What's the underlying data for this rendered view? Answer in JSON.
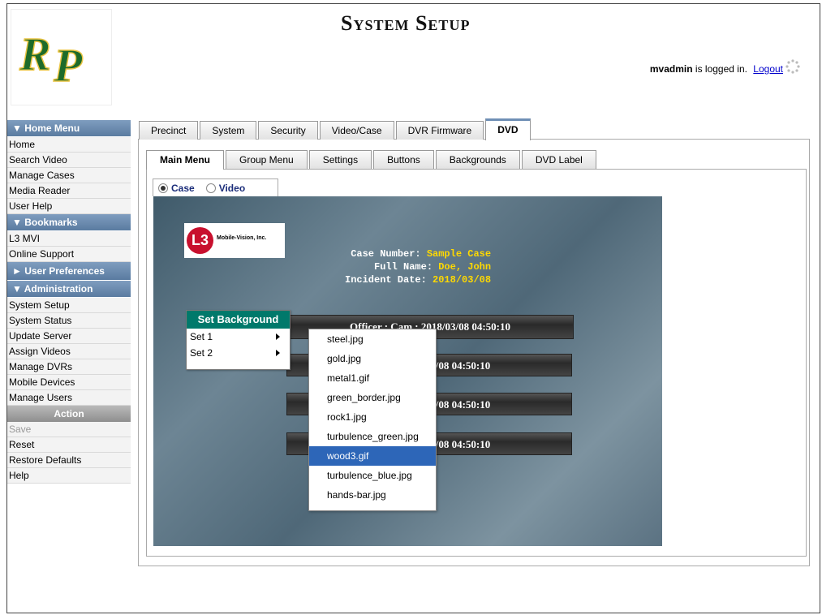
{
  "header": {
    "title": "System Setup",
    "logo_text": "RP",
    "user": "mvadmin",
    "login_suffix": "is logged in.",
    "logout": "Logout"
  },
  "sidebar": {
    "home_menu": "▼ Home Menu",
    "home_items": [
      "Home",
      "Search Video",
      "Manage Cases",
      "Media Reader",
      "User Help"
    ],
    "bookmarks": "▼ Bookmarks",
    "bookmark_items": [
      "L3 MVI",
      "Online Support"
    ],
    "user_prefs": "► User Preferences",
    "administration": "▼ Administration",
    "admin_items": [
      "System Setup",
      "System Status",
      "Update Server",
      "Assign Videos",
      "Manage DVRs",
      "Mobile Devices",
      "Manage Users"
    ],
    "action": "Action",
    "action_items": [
      "Save",
      "Reset",
      "Restore Defaults",
      "Help"
    ]
  },
  "tabs": [
    "Precinct",
    "System",
    "Security",
    "Video/Case",
    "DVR Firmware",
    "DVD"
  ],
  "subtabs": [
    "Main Menu",
    "Group Menu",
    "Settings",
    "Buttons",
    "Backgrounds",
    "DVD Label"
  ],
  "radios": {
    "case": "Case",
    "video": "Video"
  },
  "preview": {
    "logo_letters": "L3",
    "logo_caption": "Mobile-Vision, Inc.",
    "case_number_label": "Case Number:",
    "case_number": "Sample Case",
    "full_name_label": "Full Name:",
    "full_name": "Doe, John",
    "incident_label": "Incident Date:",
    "incident_date": "2018/03/08",
    "buttons": [
      "Officer : Cam : 2018/03/08 04:50:10",
      "03/08 04:50:10",
      "03/08 04:50:10",
      "03/08 04:50:10"
    ]
  },
  "context_menu": {
    "title": "Set Background",
    "items": [
      "Set 1",
      "Set 2"
    ]
  },
  "submenu": {
    "items": [
      "steel.jpg",
      "gold.jpg",
      "metal1.gif",
      "green_border.jpg",
      "rock1.jpg",
      "turbulence_green.jpg",
      "wood3.gif",
      "turbulence_blue.jpg",
      "hands-bar.jpg"
    ],
    "selected_index": 6
  },
  "colors": {
    "menu_head": "#5a7ba0",
    "ctx_head": "#00796b",
    "selection": "#2d66b8",
    "case_value": "#ffd900"
  }
}
